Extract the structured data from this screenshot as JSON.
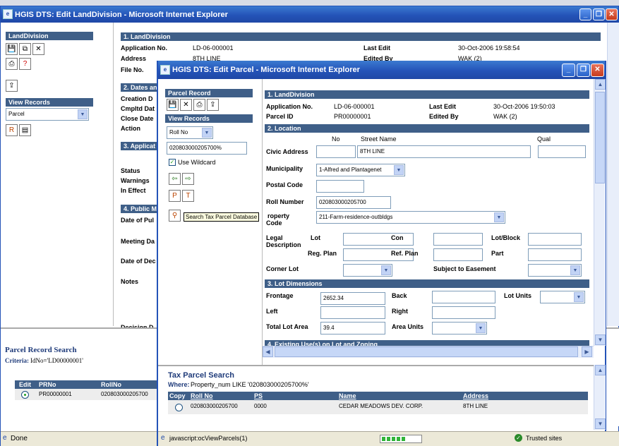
{
  "outer": {
    "title": "HGIS DTS: Edit LandDivision - Microsoft Internet Explorer",
    "sidebar": {
      "landdivision": "LandDivision",
      "view_records": "View Records",
      "view_select": "Parcel"
    },
    "section1": "1. LandDivision",
    "application_label": "Application No.",
    "application_value": "LD-06-000001",
    "address_label": "Address",
    "address_value": "8TH LINE",
    "file_label": "File No.",
    "last_edit_label": "Last Edit",
    "last_edit_value": "30-Oct-2006 19:58:54",
    "edited_by_label": "Edited By",
    "edited_by_value": "WAK (2)",
    "section2": "2. Dates an",
    "dates_labels": [
      "Creation D",
      "Cmpltd Dat",
      "Close Date",
      "Action"
    ],
    "section3": "3. Applicat",
    "status_labels": [
      "Status",
      "Warnings",
      "In Effect"
    ],
    "section4": "4. Public M",
    "public_labels": [
      "Date of Pul",
      "Meeting Da",
      "Date of Dec",
      "Notes",
      "Decision D"
    ],
    "search_title": "Parcel Record Search",
    "criteria_label": "Criteria:",
    "criteria_value": "IdNo='LD00000001'",
    "grid_headers": [
      "Edit",
      "PRNo",
      "RollNo"
    ],
    "grid_row": {
      "prno": "PR00000001",
      "rollno": "020803000205700"
    },
    "status": "Done"
  },
  "inner": {
    "title": "HGIS DTS: Edit Parcel - Microsoft Internet Explorer",
    "sidebar": {
      "parcel_record": "Parcel Record",
      "view_records": "View Records",
      "view_select": "Roll No",
      "search_value": "020803000205700%",
      "wildcard_label": "Use Wildcard",
      "tooltip": "Search Tax Parcel Database"
    },
    "section1": "1. LandDivision",
    "application_label": "Application No.",
    "application_value": "LD-06-000001",
    "last_edit_label": "Last Edit",
    "last_edit_value": "30-Oct-2006 19:50:03",
    "parcel_id_label": "Parcel ID",
    "parcel_id_value": "PR00000001",
    "edited_by_label": "Edited By",
    "edited_by_value": "WAK (2)",
    "section2": "2. Location",
    "no_header": "No",
    "street_header": "Street Name",
    "qual_header": "Qual",
    "civic_label": "Civic Address",
    "street_value": "8TH LINE",
    "municipality_label": "Municipality",
    "municipality_value": "1-Alfred and Plantagenet",
    "postal_label": "Postal Code",
    "roll_label": "Roll Number",
    "roll_value": "020803000205700",
    "property_code_label1": "roperty",
    "property_code_label2": "Code",
    "property_code_value": "211-Farm-residence-outbldgs",
    "legal_label1": "Legal",
    "legal_label2": "Description",
    "lot_label": "Lot",
    "con_label": "Con",
    "lotblock_label": "Lot/Block",
    "regplan_label": "Reg. Plan",
    "refplan_label": "Ref. Plan",
    "part_label": "Part",
    "corner_label": "Corner Lot",
    "easement_label": "Subject to Easement",
    "section3": "3. Lot Dimensions",
    "frontage_label": "Frontage",
    "frontage_value": "2652.34",
    "back_label": "Back",
    "lotunits_label": "Lot Units",
    "left_label": "Left",
    "right_label": "Right",
    "area_label": "Total Lot Area",
    "area_value": "39.4",
    "areaunits_label": "Area Units",
    "section4": "4. Existing Use(s) on Lot and Zoning",
    "tax_title": "Tax Parcel Search",
    "where_label": "Where:",
    "where_value": "Property_num LIKE '020803000205700%'",
    "tax_headers": [
      "Copy",
      "Roll No",
      "PS",
      "Name",
      "Address"
    ],
    "tax_row": {
      "roll": "020803000205700",
      "ps": "0000",
      "name": "CEDAR MEADOWS DEV. CORP.",
      "address": "8TH LINE"
    },
    "status": "javascript:ocViewParcels(1)",
    "zone": "Trusted sites"
  }
}
